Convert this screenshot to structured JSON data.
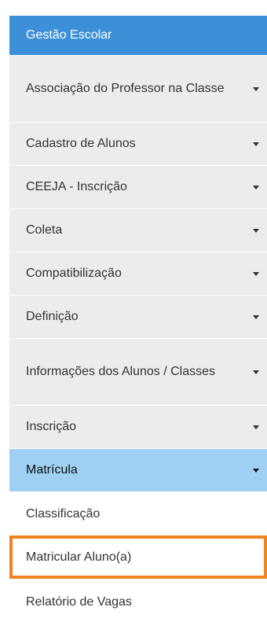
{
  "menu": {
    "title": "Gestão Escolar",
    "items": [
      {
        "label": "Associação do Professor na Classe"
      },
      {
        "label": "Cadastro de Alunos"
      },
      {
        "label": "CEEJA - Inscrição"
      },
      {
        "label": "Coleta"
      },
      {
        "label": "Compatibilização"
      },
      {
        "label": "Definição"
      },
      {
        "label": "Informações dos Alunos / Classes"
      },
      {
        "label": "Inscrição"
      },
      {
        "label": "Matrícula"
      }
    ],
    "submenu": [
      {
        "label": "Classificação"
      },
      {
        "label": "Matricular Aluno(a)"
      },
      {
        "label": "Relatório de Vagas"
      }
    ]
  },
  "colors": {
    "header_bg": "#3d8fd8",
    "item_bg": "#ececec",
    "active_bg": "#9fd0f3",
    "highlight_border": "#f28321"
  }
}
